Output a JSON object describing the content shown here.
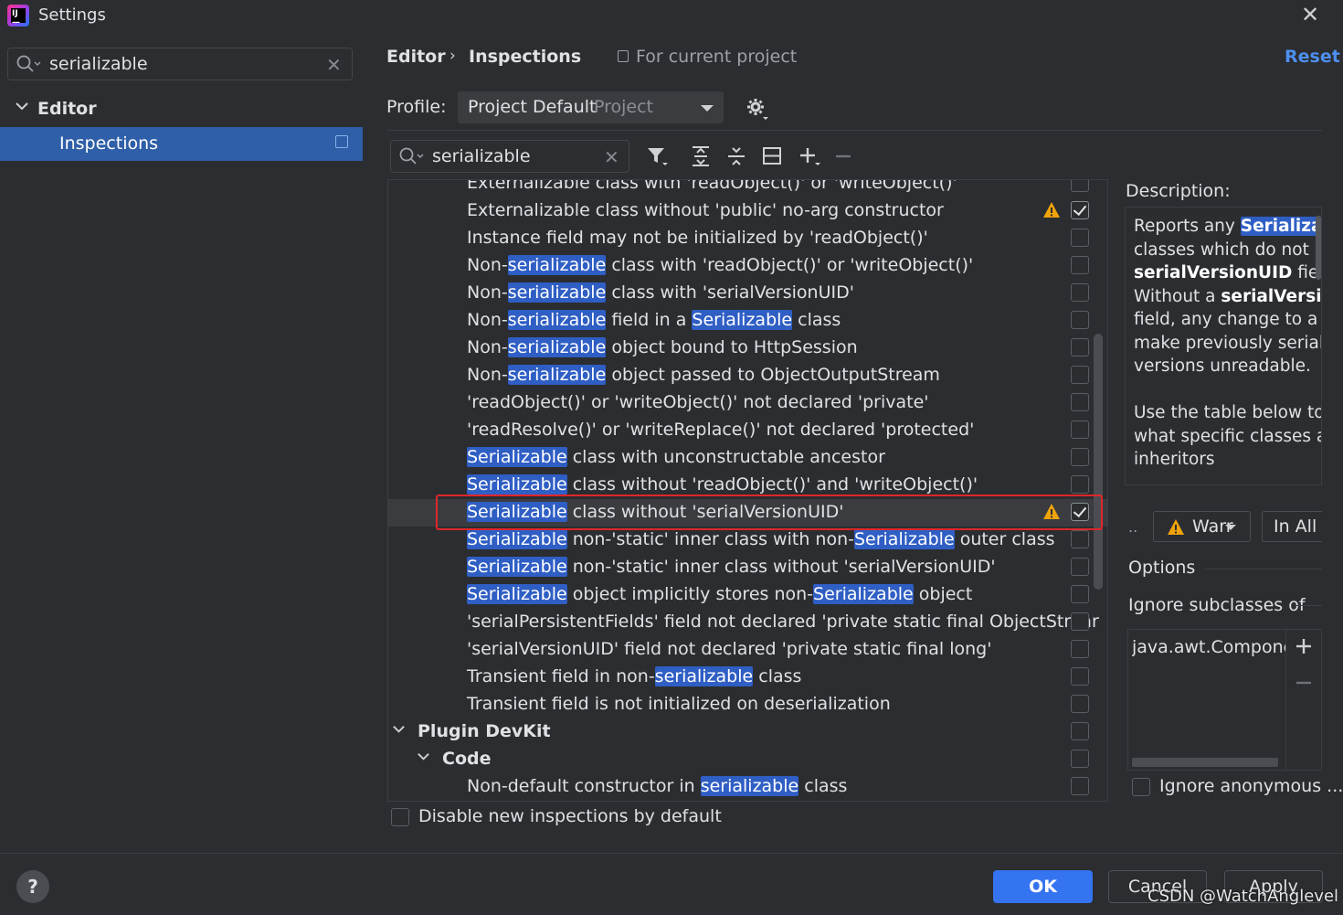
{
  "window": {
    "title": "Settings",
    "close_glyph": "✕"
  },
  "sidebar": {
    "search_value": "serializable",
    "tree": {
      "editor_label": "Editor",
      "inspections_label": "Inspections"
    }
  },
  "header": {
    "breadcrumb": [
      "Editor",
      "Inspections"
    ],
    "breadcrumb_separator": "›",
    "scope_note": "For current project",
    "reset_label": "Reset"
  },
  "profile": {
    "label": "Profile:",
    "value": "Project Default",
    "sub": "Project"
  },
  "list_search": {
    "value": "serializable"
  },
  "inspections": [
    {
      "parts": [
        [
          "Externalizable class with 'readObject()' or 'writeObject()'",
          false
        ]
      ],
      "level": 0,
      "warn": false,
      "checked": false
    },
    {
      "parts": [
        [
          "Externalizable class without 'public' no-arg constructor",
          false
        ]
      ],
      "level": 0,
      "warn": true,
      "checked": true
    },
    {
      "parts": [
        [
          "Instance field may not be initialized by 'readObject()'",
          false
        ]
      ],
      "level": 0,
      "warn": false,
      "checked": false
    },
    {
      "parts": [
        [
          "Non-",
          false
        ],
        [
          "serializable",
          true
        ],
        [
          " class with 'readObject()' or 'writeObject()'",
          false
        ]
      ],
      "level": 0,
      "warn": false,
      "checked": false
    },
    {
      "parts": [
        [
          "Non-",
          false
        ],
        [
          "serializable",
          true
        ],
        [
          " class with 'serialVersionUID'",
          false
        ]
      ],
      "level": 0,
      "warn": false,
      "checked": false
    },
    {
      "parts": [
        [
          "Non-",
          false
        ],
        [
          "serializable",
          true
        ],
        [
          " field in a ",
          false
        ],
        [
          "Serializable",
          true
        ],
        [
          " class",
          false
        ]
      ],
      "level": 0,
      "warn": false,
      "checked": false
    },
    {
      "parts": [
        [
          "Non-",
          false
        ],
        [
          "serializable",
          true
        ],
        [
          " object bound to HttpSession",
          false
        ]
      ],
      "level": 0,
      "warn": false,
      "checked": false
    },
    {
      "parts": [
        [
          "Non-",
          false
        ],
        [
          "serializable",
          true
        ],
        [
          " object passed to ObjectOutputStream",
          false
        ]
      ],
      "level": 0,
      "warn": false,
      "checked": false
    },
    {
      "parts": [
        [
          "'readObject()' or 'writeObject()' not declared 'private'",
          false
        ]
      ],
      "level": 0,
      "warn": false,
      "checked": false
    },
    {
      "parts": [
        [
          "'readResolve()' or 'writeReplace()' not declared 'protected'",
          false
        ]
      ],
      "level": 0,
      "warn": false,
      "checked": false
    },
    {
      "parts": [
        [
          "Serializable",
          true
        ],
        [
          " class with unconstructable ancestor",
          false
        ]
      ],
      "level": 0,
      "warn": false,
      "checked": false
    },
    {
      "parts": [
        [
          "Serializable",
          true
        ],
        [
          " class without 'readObject()' and 'writeObject()'",
          false
        ]
      ],
      "level": 0,
      "warn": false,
      "checked": false
    },
    {
      "parts": [
        [
          "Serializable",
          true
        ],
        [
          " class without 'serialVersionUID'",
          false
        ]
      ],
      "level": 0,
      "warn": true,
      "checked": true,
      "selected": true
    },
    {
      "parts": [
        [
          "Serializable",
          true
        ],
        [
          " non-'static' inner class with non-",
          false
        ],
        [
          "Serializable",
          true
        ],
        [
          " outer class",
          false
        ]
      ],
      "level": 0,
      "warn": false,
      "checked": false
    },
    {
      "parts": [
        [
          "Serializable",
          true
        ],
        [
          " non-'static' inner class without 'serialVersionUID'",
          false
        ]
      ],
      "level": 0,
      "warn": false,
      "checked": false
    },
    {
      "parts": [
        [
          "Serializable",
          true
        ],
        [
          " object implicitly stores non-",
          false
        ],
        [
          "Serializable",
          true
        ],
        [
          " object",
          false
        ]
      ],
      "level": 0,
      "warn": false,
      "checked": false
    },
    {
      "parts": [
        [
          "'serialPersistentFields' field not declared 'private static final ObjectStrear",
          false
        ]
      ],
      "level": 0,
      "warn": false,
      "checked": false
    },
    {
      "parts": [
        [
          "'serialVersionUID' field not declared 'private static final long'",
          false
        ]
      ],
      "level": 0,
      "warn": false,
      "checked": false
    },
    {
      "parts": [
        [
          "Transient field in non-",
          false
        ],
        [
          "serializable",
          true
        ],
        [
          " class",
          false
        ]
      ],
      "level": 0,
      "warn": false,
      "checked": false
    },
    {
      "parts": [
        [
          "Transient field is not initialized on deserialization",
          false
        ]
      ],
      "level": 0,
      "warn": false,
      "checked": false
    },
    {
      "parts": [
        [
          "Plugin DevKit",
          false
        ]
      ],
      "group": 1,
      "warn": false,
      "checked": false
    },
    {
      "parts": [
        [
          "Code",
          false
        ]
      ],
      "group": 2,
      "warn": false,
      "checked": false
    },
    {
      "parts": [
        [
          "Non-default constructor in ",
          false
        ],
        [
          "serializable",
          true
        ],
        [
          " class",
          false
        ]
      ],
      "level": 0,
      "warn": false,
      "checked": false
    }
  ],
  "disable_new": {
    "label": "Disable new inspections by default",
    "checked": false
  },
  "description": {
    "title": "Description:",
    "html_parts": [
      [
        "Reports any ",
        "t"
      ],
      [
        "Serializable",
        "hl"
      ],
      [
        " classes which do not provide a ",
        "t"
      ],
      [
        "serialVersionUID",
        "b"
      ],
      [
        " field. Without a ",
        "t"
      ],
      [
        "serialVersionUID",
        "b"
      ],
      [
        " field, any change to a class will make previously serialized versions unreadable.",
        "t"
      ],
      [
        "BR",
        "br"
      ],
      [
        "Use the table below to specify what specific classes and inheritors",
        "t"
      ]
    ]
  },
  "severity": {
    "dots": "..",
    "value": "Warning",
    "display": "Warr",
    "scope": "In All Scopes"
  },
  "options": {
    "title": "Options",
    "ignore_subclasses_label": "Ignore subclasses of",
    "ignore_subclasses_items": [
      "java.awt.Component"
    ],
    "ignore_anonymous_label": "Ignore anonymous ...",
    "ignore_anonymous_checked": false
  },
  "footer": {
    "help": "?",
    "ok": "OK",
    "cancel": "Cancel",
    "apply": "Apply"
  },
  "watermark": "CSDN @WatchAnglevel",
  "colors": {
    "accent": "#3574f0",
    "highlight": "#2f5ec4",
    "selection_outline": "#e0262a",
    "warning": "#f0a30a"
  }
}
